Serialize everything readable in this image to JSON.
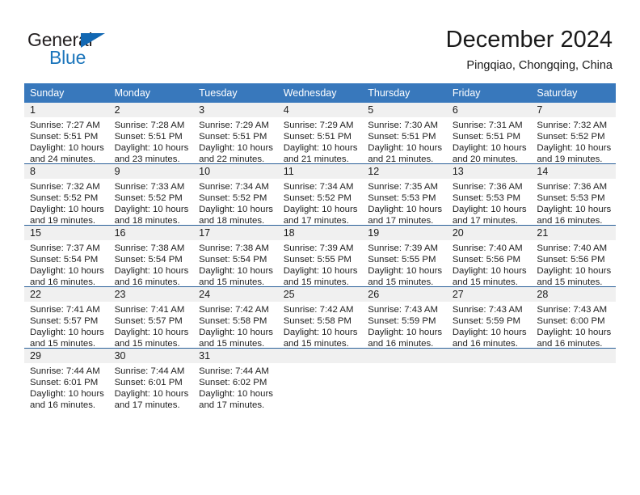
{
  "brand": {
    "name_part1": "General",
    "name_part2": "Blue",
    "triangle_color": "#1268b3",
    "blue_color": "#1b75bb"
  },
  "header": {
    "title": "December 2024",
    "subtitle": "Pingqiao, Chongqing, China"
  },
  "theme": {
    "header_row_bg": "#3878bc",
    "daynum_bg": "#f0f0f0",
    "row_divider": "#2a6099"
  },
  "weekday_headers": [
    "Sunday",
    "Monday",
    "Tuesday",
    "Wednesday",
    "Thursday",
    "Friday",
    "Saturday"
  ],
  "labels": {
    "sunrise_prefix": "Sunrise:",
    "sunset_prefix": "Sunset:",
    "daylight_prefix": "Daylight:"
  },
  "weeks": [
    {
      "days": [
        {
          "day": "1",
          "sunrise": "Sunrise: 7:27 AM",
          "sunset": "Sunset: 5:51 PM",
          "daylight_line1": "Daylight: 10 hours",
          "daylight_line2": "and 24 minutes."
        },
        {
          "day": "2",
          "sunrise": "Sunrise: 7:28 AM",
          "sunset": "Sunset: 5:51 PM",
          "daylight_line1": "Daylight: 10 hours",
          "daylight_line2": "and 23 minutes."
        },
        {
          "day": "3",
          "sunrise": "Sunrise: 7:29 AM",
          "sunset": "Sunset: 5:51 PM",
          "daylight_line1": "Daylight: 10 hours",
          "daylight_line2": "and 22 minutes."
        },
        {
          "day": "4",
          "sunrise": "Sunrise: 7:29 AM",
          "sunset": "Sunset: 5:51 PM",
          "daylight_line1": "Daylight: 10 hours",
          "daylight_line2": "and 21 minutes."
        },
        {
          "day": "5",
          "sunrise": "Sunrise: 7:30 AM",
          "sunset": "Sunset: 5:51 PM",
          "daylight_line1": "Daylight: 10 hours",
          "daylight_line2": "and 21 minutes."
        },
        {
          "day": "6",
          "sunrise": "Sunrise: 7:31 AM",
          "sunset": "Sunset: 5:51 PM",
          "daylight_line1": "Daylight: 10 hours",
          "daylight_line2": "and 20 minutes."
        },
        {
          "day": "7",
          "sunrise": "Sunrise: 7:32 AM",
          "sunset": "Sunset: 5:52 PM",
          "daylight_line1": "Daylight: 10 hours",
          "daylight_line2": "and 19 minutes."
        }
      ]
    },
    {
      "days": [
        {
          "day": "8",
          "sunrise": "Sunrise: 7:32 AM",
          "sunset": "Sunset: 5:52 PM",
          "daylight_line1": "Daylight: 10 hours",
          "daylight_line2": "and 19 minutes."
        },
        {
          "day": "9",
          "sunrise": "Sunrise: 7:33 AM",
          "sunset": "Sunset: 5:52 PM",
          "daylight_line1": "Daylight: 10 hours",
          "daylight_line2": "and 18 minutes."
        },
        {
          "day": "10",
          "sunrise": "Sunrise: 7:34 AM",
          "sunset": "Sunset: 5:52 PM",
          "daylight_line1": "Daylight: 10 hours",
          "daylight_line2": "and 18 minutes."
        },
        {
          "day": "11",
          "sunrise": "Sunrise: 7:34 AM",
          "sunset": "Sunset: 5:52 PM",
          "daylight_line1": "Daylight: 10 hours",
          "daylight_line2": "and 17 minutes."
        },
        {
          "day": "12",
          "sunrise": "Sunrise: 7:35 AM",
          "sunset": "Sunset: 5:53 PM",
          "daylight_line1": "Daylight: 10 hours",
          "daylight_line2": "and 17 minutes."
        },
        {
          "day": "13",
          "sunrise": "Sunrise: 7:36 AM",
          "sunset": "Sunset: 5:53 PM",
          "daylight_line1": "Daylight: 10 hours",
          "daylight_line2": "and 17 minutes."
        },
        {
          "day": "14",
          "sunrise": "Sunrise: 7:36 AM",
          "sunset": "Sunset: 5:53 PM",
          "daylight_line1": "Daylight: 10 hours",
          "daylight_line2": "and 16 minutes."
        }
      ]
    },
    {
      "days": [
        {
          "day": "15",
          "sunrise": "Sunrise: 7:37 AM",
          "sunset": "Sunset: 5:54 PM",
          "daylight_line1": "Daylight: 10 hours",
          "daylight_line2": "and 16 minutes."
        },
        {
          "day": "16",
          "sunrise": "Sunrise: 7:38 AM",
          "sunset": "Sunset: 5:54 PM",
          "daylight_line1": "Daylight: 10 hours",
          "daylight_line2": "and 16 minutes."
        },
        {
          "day": "17",
          "sunrise": "Sunrise: 7:38 AM",
          "sunset": "Sunset: 5:54 PM",
          "daylight_line1": "Daylight: 10 hours",
          "daylight_line2": "and 15 minutes."
        },
        {
          "day": "18",
          "sunrise": "Sunrise: 7:39 AM",
          "sunset": "Sunset: 5:55 PM",
          "daylight_line1": "Daylight: 10 hours",
          "daylight_line2": "and 15 minutes."
        },
        {
          "day": "19",
          "sunrise": "Sunrise: 7:39 AM",
          "sunset": "Sunset: 5:55 PM",
          "daylight_line1": "Daylight: 10 hours",
          "daylight_line2": "and 15 minutes."
        },
        {
          "day": "20",
          "sunrise": "Sunrise: 7:40 AM",
          "sunset": "Sunset: 5:56 PM",
          "daylight_line1": "Daylight: 10 hours",
          "daylight_line2": "and 15 minutes."
        },
        {
          "day": "21",
          "sunrise": "Sunrise: 7:40 AM",
          "sunset": "Sunset: 5:56 PM",
          "daylight_line1": "Daylight: 10 hours",
          "daylight_line2": "and 15 minutes."
        }
      ]
    },
    {
      "days": [
        {
          "day": "22",
          "sunrise": "Sunrise: 7:41 AM",
          "sunset": "Sunset: 5:57 PM",
          "daylight_line1": "Daylight: 10 hours",
          "daylight_line2": "and 15 minutes."
        },
        {
          "day": "23",
          "sunrise": "Sunrise: 7:41 AM",
          "sunset": "Sunset: 5:57 PM",
          "daylight_line1": "Daylight: 10 hours",
          "daylight_line2": "and 15 minutes."
        },
        {
          "day": "24",
          "sunrise": "Sunrise: 7:42 AM",
          "sunset": "Sunset: 5:58 PM",
          "daylight_line1": "Daylight: 10 hours",
          "daylight_line2": "and 15 minutes."
        },
        {
          "day": "25",
          "sunrise": "Sunrise: 7:42 AM",
          "sunset": "Sunset: 5:58 PM",
          "daylight_line1": "Daylight: 10 hours",
          "daylight_line2": "and 15 minutes."
        },
        {
          "day": "26",
          "sunrise": "Sunrise: 7:43 AM",
          "sunset": "Sunset: 5:59 PM",
          "daylight_line1": "Daylight: 10 hours",
          "daylight_line2": "and 16 minutes."
        },
        {
          "day": "27",
          "sunrise": "Sunrise: 7:43 AM",
          "sunset": "Sunset: 5:59 PM",
          "daylight_line1": "Daylight: 10 hours",
          "daylight_line2": "and 16 minutes."
        },
        {
          "day": "28",
          "sunrise": "Sunrise: 7:43 AM",
          "sunset": "Sunset: 6:00 PM",
          "daylight_line1": "Daylight: 10 hours",
          "daylight_line2": "and 16 minutes."
        }
      ]
    },
    {
      "days": [
        {
          "day": "29",
          "sunrise": "Sunrise: 7:44 AM",
          "sunset": "Sunset: 6:01 PM",
          "daylight_line1": "Daylight: 10 hours",
          "daylight_line2": "and 16 minutes."
        },
        {
          "day": "30",
          "sunrise": "Sunrise: 7:44 AM",
          "sunset": "Sunset: 6:01 PM",
          "daylight_line1": "Daylight: 10 hours",
          "daylight_line2": "and 17 minutes."
        },
        {
          "day": "31",
          "sunrise": "Sunrise: 7:44 AM",
          "sunset": "Sunset: 6:02 PM",
          "daylight_line1": "Daylight: 10 hours",
          "daylight_line2": "and 17 minutes."
        },
        {
          "day": "",
          "sunrise": "",
          "sunset": "",
          "daylight_line1": "",
          "daylight_line2": ""
        },
        {
          "day": "",
          "sunrise": "",
          "sunset": "",
          "daylight_line1": "",
          "daylight_line2": ""
        },
        {
          "day": "",
          "sunrise": "",
          "sunset": "",
          "daylight_line1": "",
          "daylight_line2": ""
        },
        {
          "day": "",
          "sunrise": "",
          "sunset": "",
          "daylight_line1": "",
          "daylight_line2": ""
        }
      ]
    }
  ]
}
